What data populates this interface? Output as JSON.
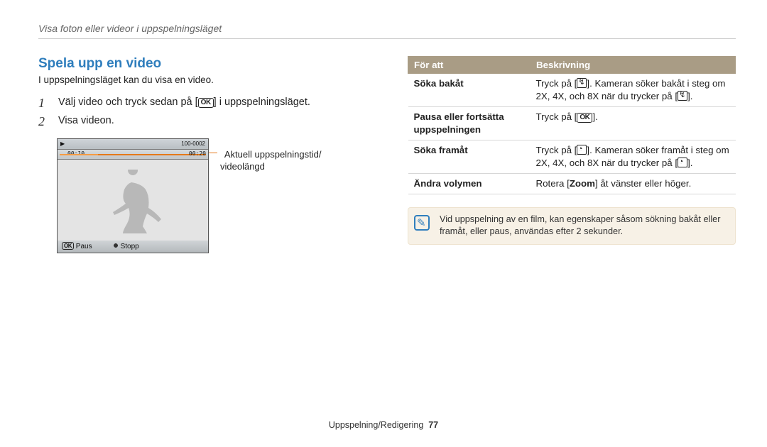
{
  "breadcrumb": "Visa foton eller videor i uppspelningsläget",
  "heading": "Spela upp en video",
  "intro": "I uppspelningsläget kan du visa en video.",
  "steps": [
    {
      "num": "1",
      "pre": "Välj video och tryck sedan på [",
      "post": "] i uppspelningsläget."
    },
    {
      "num": "2",
      "pre": "Visa videon.",
      "post": ""
    }
  ],
  "callout": {
    "line1": "Aktuell uppspelningstid/",
    "line2": "videolängd"
  },
  "screenshot": {
    "top_right": "100-0002",
    "time_left": "00:10",
    "time_right": "00:20",
    "paus_label": "Paus",
    "stopp_label": "Stopp"
  },
  "table": {
    "headers": {
      "for_att": "För att",
      "beskrivning": "Beskrivning"
    },
    "rows": [
      {
        "label": "Söka bakåt",
        "desc_pre": "Tryck på [",
        "icon1": "flash",
        "desc_mid": "]. Kameran söker bakåt i steg om 2X, 4X, och 8X när du trycker på [",
        "icon2": "flash",
        "desc_post": "]."
      },
      {
        "label": "Pausa eller fortsätta uppspelningen",
        "desc_pre": "Tryck på [",
        "icon1": "ok",
        "desc_mid": "",
        "desc_post": "]."
      },
      {
        "label": "Söka framåt",
        "desc_pre": "Tryck på [",
        "icon1": "timer",
        "desc_mid": "]. Kameran söker framåt i steg om 2X, 4X, och 8X när du trycker på [",
        "icon2": "timer",
        "desc_post": "]."
      },
      {
        "label": "Ändra volymen",
        "desc_pre": "Rotera [",
        "bold": "Zoom",
        "desc_post2": "] åt vänster eller höger."
      }
    ]
  },
  "note": "Vid uppspelning av en film, kan egenskaper såsom sökning bakåt eller framåt, eller paus, användas efter 2 sekunder.",
  "footer": {
    "section": "Uppspelning/Redigering",
    "page": "77"
  },
  "ok_label": "OK"
}
